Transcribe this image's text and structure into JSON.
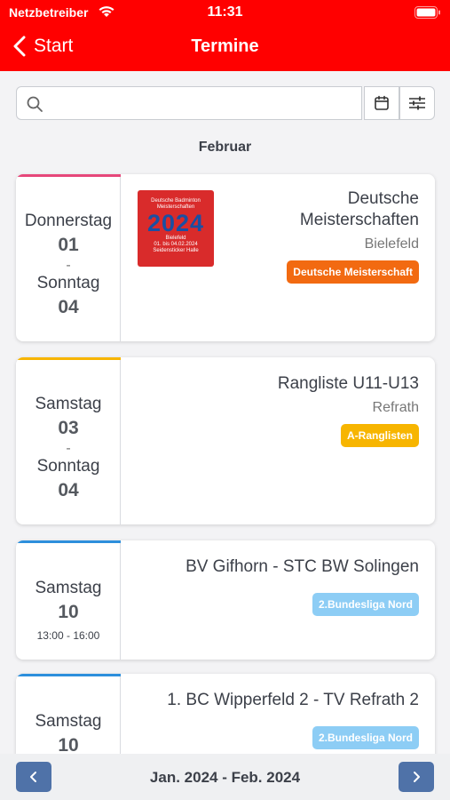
{
  "status": {
    "carrier": "Netzbetreiber",
    "time": "11:31"
  },
  "nav": {
    "back_label": "Start",
    "title": "Termine"
  },
  "search": {
    "placeholder": ""
  },
  "month": "Februar",
  "colors": {
    "header": "#ff0000",
    "badge_dm": "#f26a11",
    "badge_rangliste": "#f7b500",
    "badge_bundesliga": "#8dcdf5",
    "bar_pink": "#e6477a",
    "bar_yellow": "#f7b500",
    "bar_blue": "#2d8fdc",
    "pager": "#4f72a8"
  },
  "events": [
    {
      "start_day": "Donnerstag",
      "start_num": "01",
      "sep": "-",
      "end_day": "Sonntag",
      "end_num": "04",
      "title_line1": "Deutsche",
      "title_line2": "Meisterschaften",
      "location": "Bielefeld",
      "badge": "Deutsche Meisterschaft",
      "logo": {
        "line1": "Deutsche Badminton",
        "line2": "Meisterschaften",
        "year": "2024",
        "line3": "Bielefeld",
        "line4": "01. bis 04.02.2024",
        "line5": "Seidensticker Halle"
      }
    },
    {
      "start_day": "Samstag",
      "start_num": "03",
      "sep": "-",
      "end_day": "Sonntag",
      "end_num": "04",
      "title": "Rangliste U11-U13",
      "location": "Refrath",
      "badge": "A-Ranglisten"
    },
    {
      "day": "Samstag",
      "num": "10",
      "time": "13:00 - 16:00",
      "title": "BV Gifhorn - STC BW Solingen",
      "badge": "2.Bundesliga Nord"
    },
    {
      "day": "Samstag",
      "num": "10",
      "title": "1. BC Wipperfeld 2 - TV Refrath 2",
      "badge": "2.Bundesliga Nord"
    }
  ],
  "footer": {
    "range": "Jan. 2024 - Feb. 2024"
  }
}
